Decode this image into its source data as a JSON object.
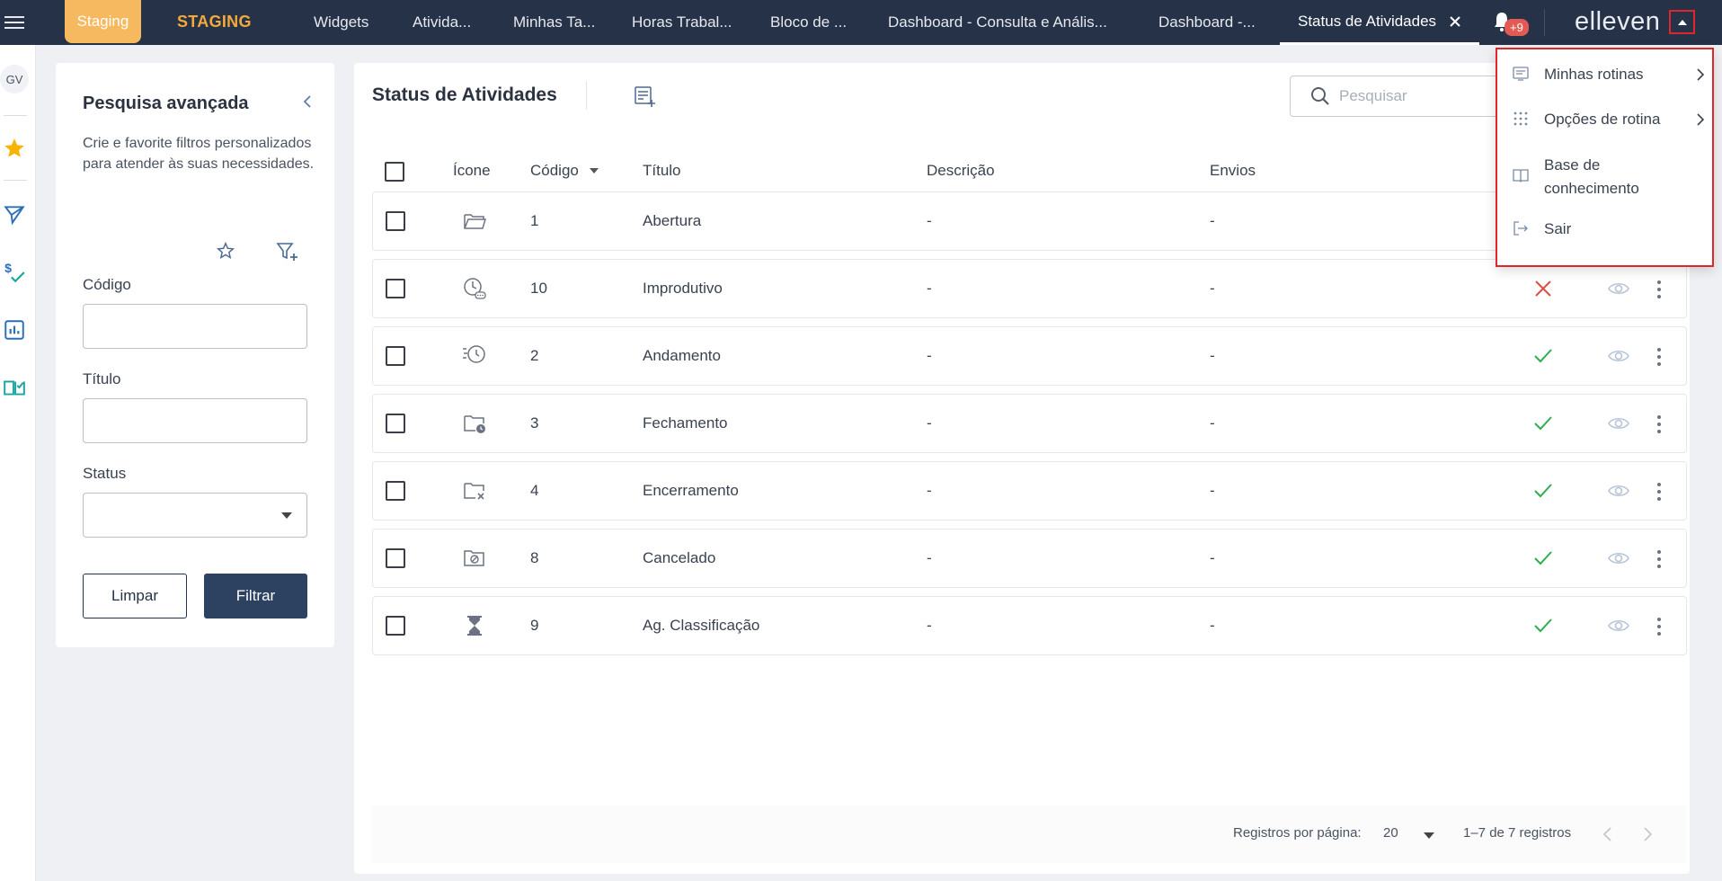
{
  "topbar": {
    "env_badge": "Staging",
    "env_label": "STAGING",
    "tabs": [
      {
        "label": "Widgets"
      },
      {
        "label": "Ativida..."
      },
      {
        "label": "Minhas Ta..."
      },
      {
        "label": "Horas Trabal..."
      },
      {
        "label": "Bloco de ..."
      },
      {
        "label": "Dashboard - Consulta e Anális..."
      },
      {
        "label": "Dashboard -..."
      },
      {
        "label": "Status de Atividades",
        "active": true
      }
    ],
    "notification_count": "+9",
    "brand": "elleven"
  },
  "leftrail": {
    "avatar_initials": "GV",
    "icons": [
      "star-icon",
      "send-icon",
      "dollar-check-icon",
      "chart-icon",
      "book-icon"
    ]
  },
  "filter_panel": {
    "title": "Pesquisa avançada",
    "description": "Crie e favorite filtros personalizados para atender às suas necessidades.",
    "fields": {
      "codigo_label": "Código",
      "titulo_label": "Título",
      "status_label": "Status"
    },
    "clear_label": "Limpar",
    "filter_label": "Filtrar"
  },
  "main": {
    "title": "Status de Atividades",
    "search_placeholder": "Pesquisar",
    "columns": {
      "icone": "Ícone",
      "codigo": "Código",
      "titulo": "Título",
      "descricao": "Descrição",
      "envios": "Envios"
    },
    "rows": [
      {
        "icon": "folder-open-icon",
        "codigo": "1",
        "titulo": "Abertura",
        "descricao": "-",
        "envios": "-",
        "status": "hidden"
      },
      {
        "icon": "clock-list-icon",
        "codigo": "10",
        "titulo": "Improdutivo",
        "descricao": "-",
        "envios": "-",
        "status": "inactive"
      },
      {
        "icon": "fast-clock-icon",
        "codigo": "2",
        "titulo": "Andamento",
        "descricao": "-",
        "envios": "-",
        "status": "active"
      },
      {
        "icon": "folder-clock-icon",
        "codigo": "3",
        "titulo": "Fechamento",
        "descricao": "-",
        "envios": "-",
        "status": "active"
      },
      {
        "icon": "folder-x-icon",
        "codigo": "4",
        "titulo": "Encerramento",
        "descricao": "-",
        "envios": "-",
        "status": "active"
      },
      {
        "icon": "folder-cancel-icon",
        "codigo": "8",
        "titulo": "Cancelado",
        "descricao": "-",
        "envios": "-",
        "status": "active"
      },
      {
        "icon": "hourglass-icon",
        "codigo": "9",
        "titulo": "Ag. Classificação",
        "descricao": "-",
        "envios": "-",
        "status": "active"
      }
    ],
    "footer": {
      "per_page_label": "Registros por página:",
      "per_page_value": "20",
      "range": "1–7 de 7 registros"
    }
  },
  "user_menu": {
    "items": [
      {
        "label": "Minhas rotinas",
        "icon": "routines-icon",
        "has_submenu": true
      },
      {
        "label": "Opções de rotina",
        "icon": "grid-dots-icon",
        "has_submenu": true
      },
      {
        "label": "Base de conhecimento",
        "icon": "book-open-icon",
        "has_submenu": false
      },
      {
        "label": "Sair",
        "icon": "logout-icon",
        "has_submenu": false
      }
    ]
  },
  "colors": {
    "topbar": "#263247",
    "staging_badge": "#f6b95f",
    "staging_text": "#f5a93b",
    "primary_button": "#2d4260",
    "success": "#2fae4e",
    "danger": "#e04b43",
    "highlight_border": "#e0262b"
  }
}
